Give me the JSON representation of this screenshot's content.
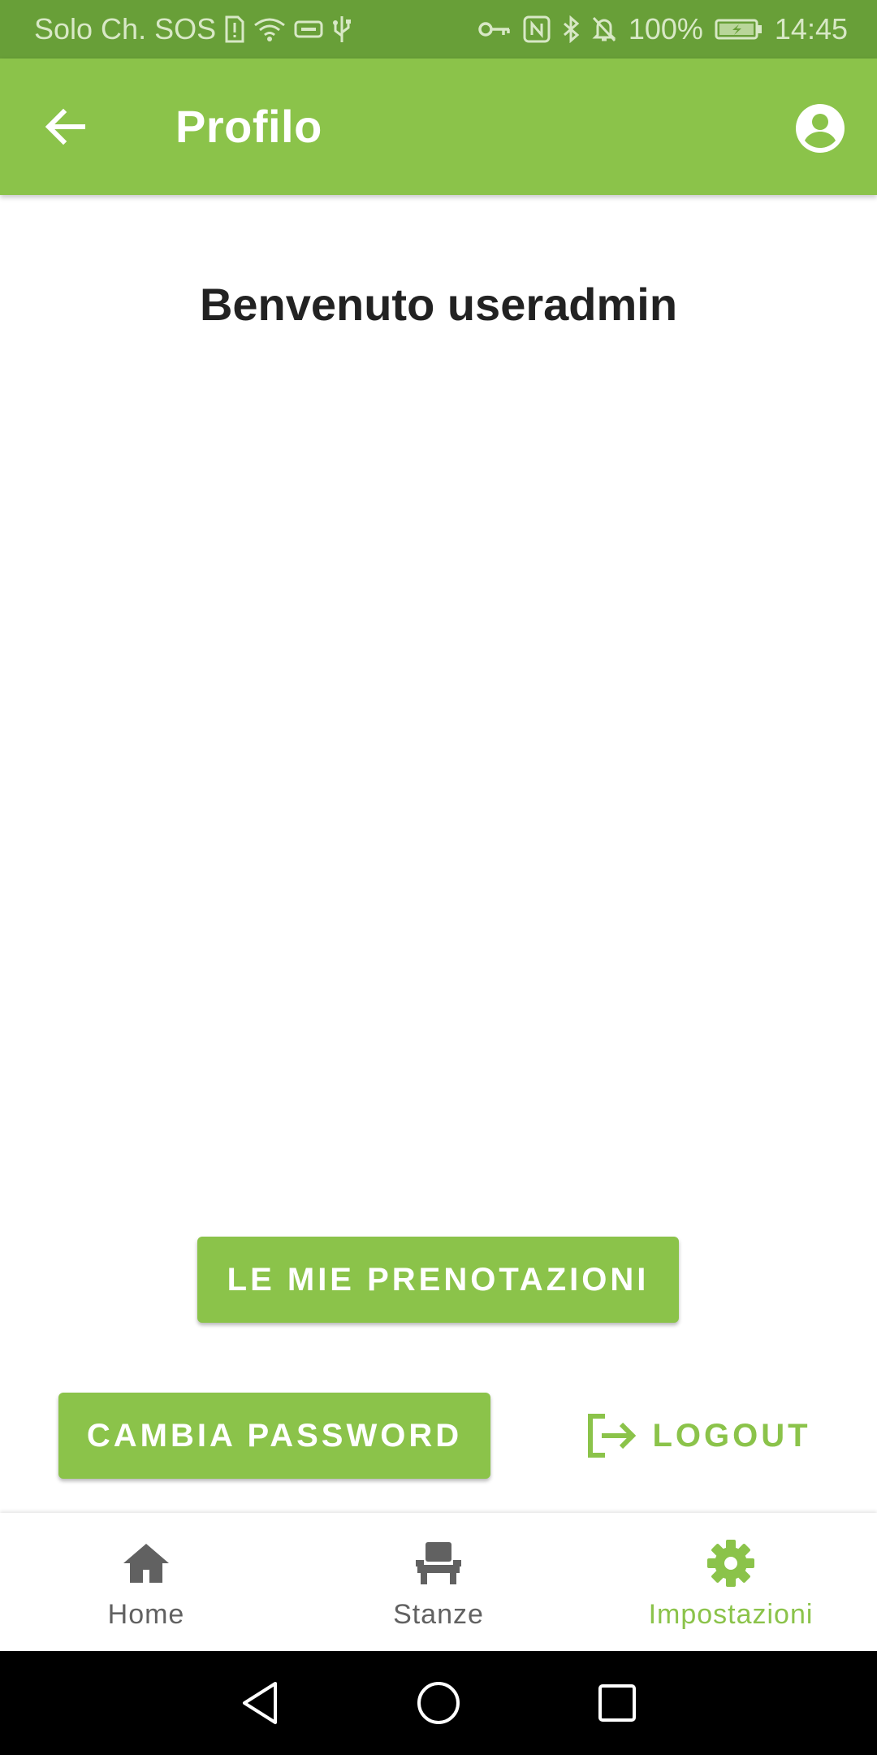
{
  "status_bar": {
    "carrier": "Solo Ch. SOS",
    "battery": "100%",
    "time": "14:45"
  },
  "app_bar": {
    "title": "Profilo"
  },
  "content": {
    "welcome": "Benvenuto useradmin",
    "bookings_button": "LE MIE PRENOTAZIONI",
    "change_password_button": "CAMBIA PASSWORD",
    "logout_button": "LOGOUT"
  },
  "bottom_nav": {
    "items": [
      {
        "label": "Home",
        "icon": "home-icon",
        "active": false
      },
      {
        "label": "Stanze",
        "icon": "chair-icon",
        "active": false
      },
      {
        "label": "Impostazioni",
        "icon": "gear-icon",
        "active": true
      }
    ]
  },
  "colors": {
    "primary": "#8bc34a",
    "status_bar": "#689f38",
    "inactive": "#616161"
  }
}
